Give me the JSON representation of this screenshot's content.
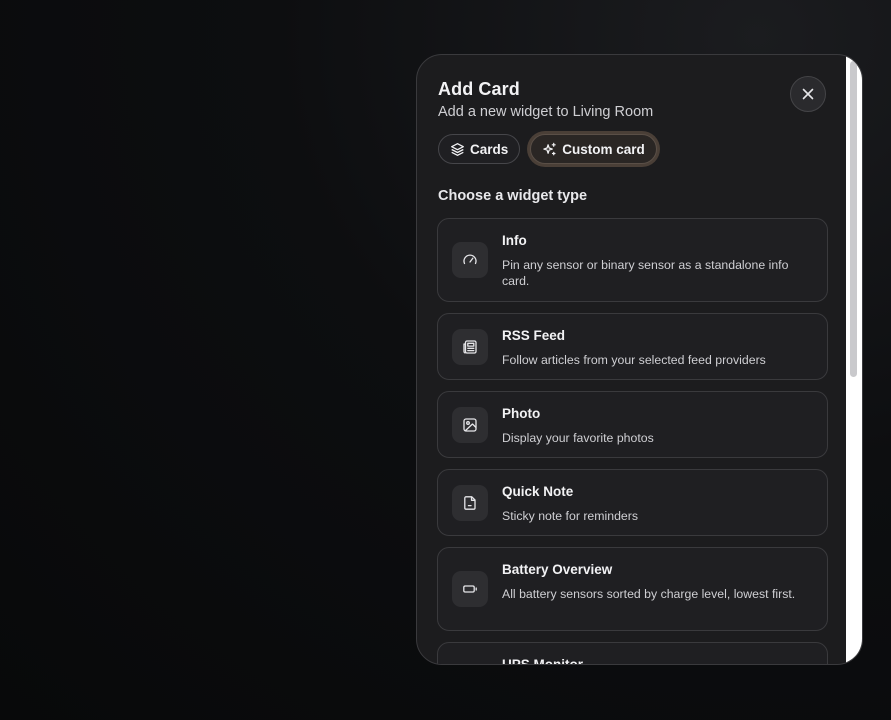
{
  "dialog": {
    "title": "Add Card",
    "subtitle": "Add a new widget to Living Room",
    "close_icon": "close-icon"
  },
  "tabs": [
    {
      "label": "Cards",
      "icon": "layers-icon",
      "active": false
    },
    {
      "label": "Custom card",
      "icon": "sparkles-icon",
      "active": true
    }
  ],
  "section": {
    "title": "Choose a widget type"
  },
  "widgets": [
    {
      "title": "Info",
      "description": "Pin any sensor or binary sensor as a standalone info card.",
      "icon": "gauge-icon"
    },
    {
      "title": "RSS Feed",
      "description": "Follow articles from your selected feed providers",
      "icon": "newspaper-icon"
    },
    {
      "title": "Photo",
      "description": "Display your favorite photos",
      "icon": "image-icon"
    },
    {
      "title": "Quick Note",
      "description": "Sticky note for reminders",
      "icon": "note-icon"
    },
    {
      "title": "Battery Overview",
      "description": "All battery sensors sorted by charge level, lowest first.",
      "icon": "battery-icon"
    },
    {
      "title": "UPS Monitor",
      "description": "",
      "icon": "ups-icon"
    }
  ],
  "colors": {
    "panel_bg": "#1c1c1e",
    "card_bg": "#1f1f22",
    "active_tab_ring": "#4a3f37",
    "text_primary": "#f2f2f4"
  }
}
